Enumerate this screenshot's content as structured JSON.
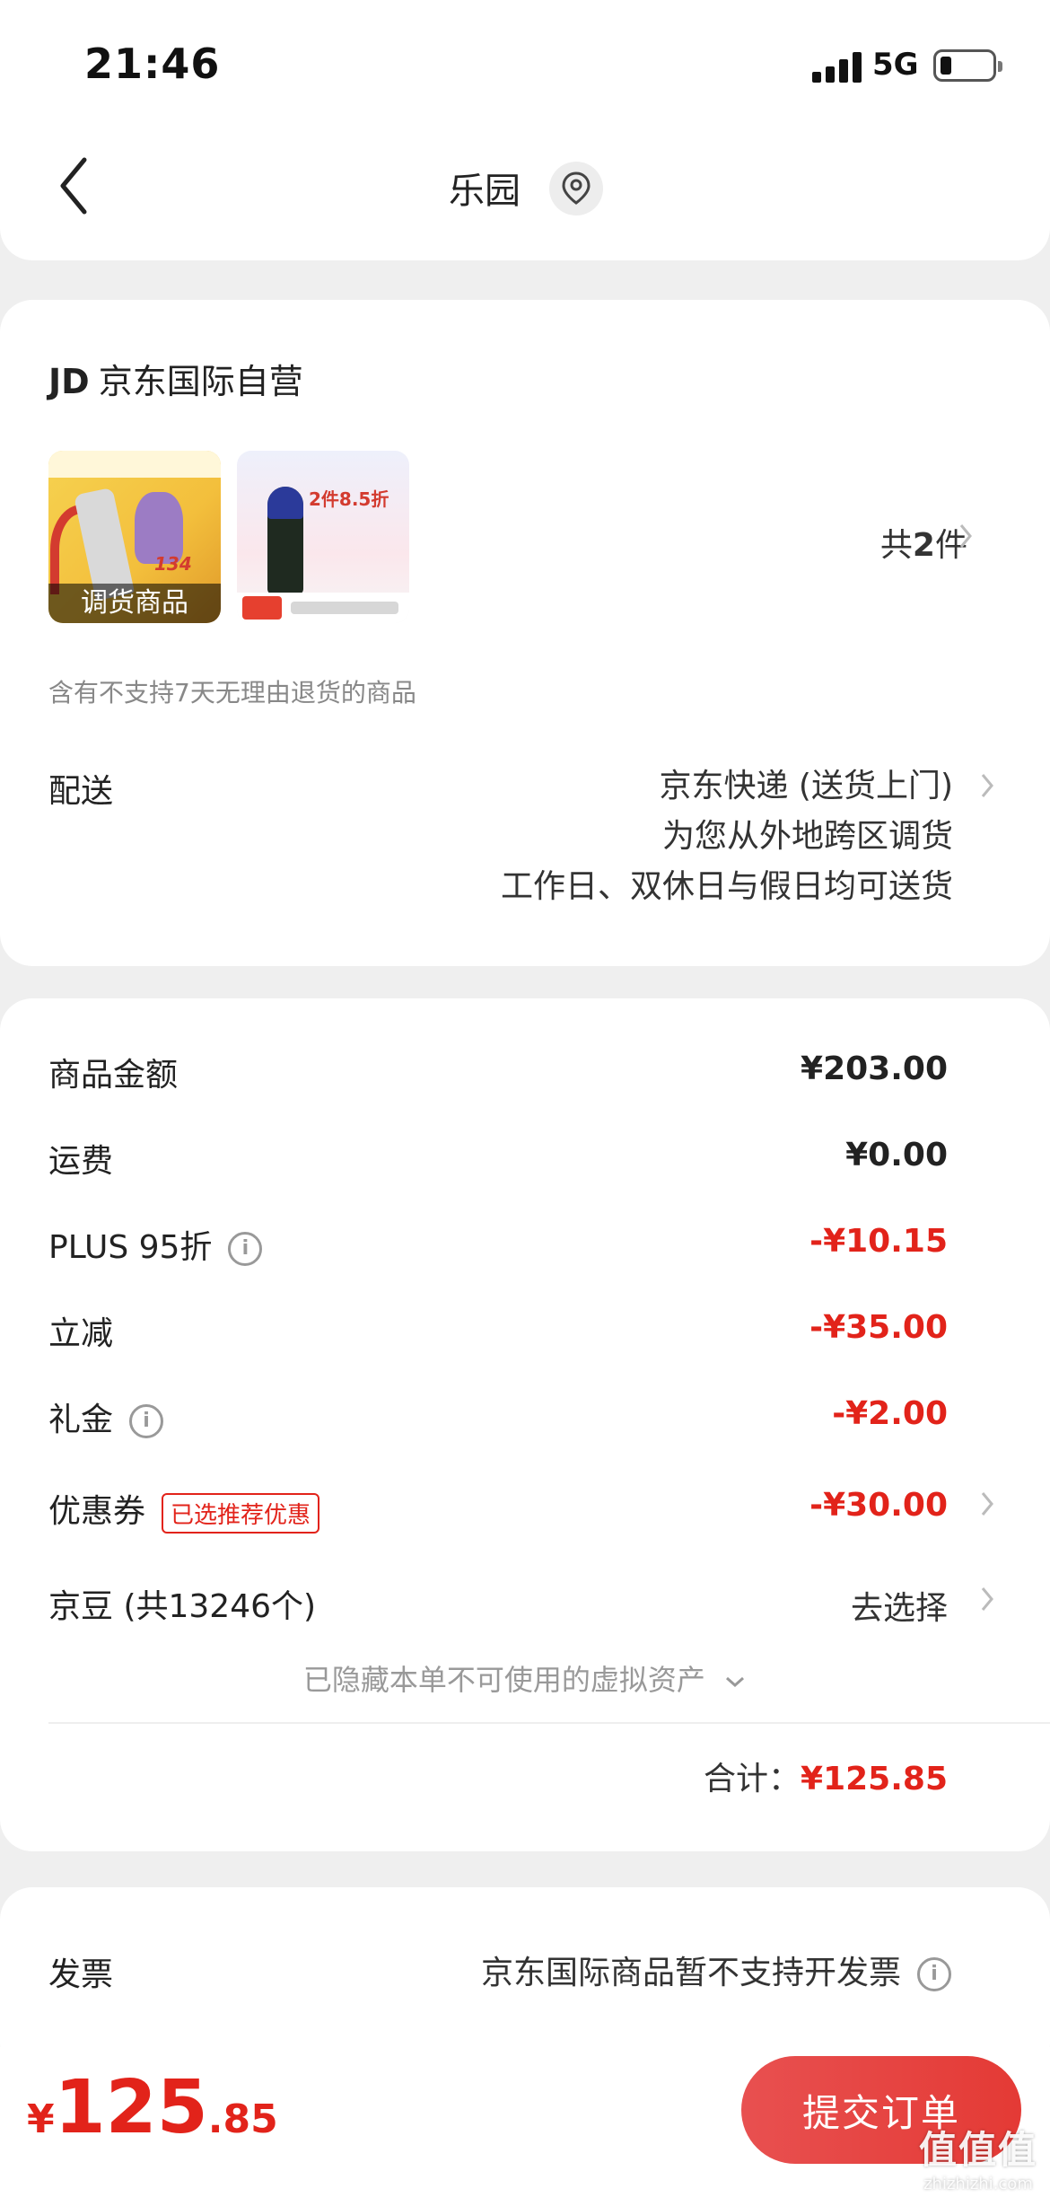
{
  "status_bar": {
    "time": "21:46",
    "network": "5G"
  },
  "header": {
    "title": "乐园",
    "back_icon": "chevron-left-icon",
    "location_icon": "location-pin-icon"
  },
  "shop": {
    "logo": "JD",
    "name": "京东国际自营",
    "thumb_label": "调货商品",
    "item_count_prefix": "共",
    "item_count": "2",
    "item_count_suffix": "件",
    "notice": "含有不支持7天无理由退货的商品",
    "delivery_label": "配送",
    "delivery_lines": [
      "京东快递 (送货上门)",
      "为您从外地跨区调货",
      "工作日、双休日与假日均可送货"
    ]
  },
  "fees": {
    "goods_label": "商品金额",
    "goods_value": "¥203.00",
    "shipping_label": "运费",
    "shipping_value": "¥0.00",
    "plus_label": "PLUS 95折",
    "plus_value": "-¥10.15",
    "instant_label": "立减",
    "instant_value": "-¥35.00",
    "gift_label": "礼金",
    "gift_value": "-¥2.00",
    "coupon_label": "优惠券",
    "coupon_tag": "已选推荐优惠",
    "coupon_value": "-¥30.00",
    "jingdou_label": "京豆 (共13246个)",
    "jingdou_value": "去选择",
    "hidden_hint": "已隐藏本单不可使用的虚拟资产",
    "total_label": "合计：",
    "total_value": "¥125.85"
  },
  "invoice": {
    "label": "发票",
    "value": "京东国际商品暂不支持开发票"
  },
  "bottom": {
    "currency": "¥",
    "amount_int": "125",
    "amount_dec": ".85",
    "submit_label": "提交订单"
  },
  "watermark": {
    "text": "值值值",
    "sub": "zhizhizhi.com"
  },
  "colors": {
    "accent": "#e2231a",
    "button": "#e43a35"
  }
}
